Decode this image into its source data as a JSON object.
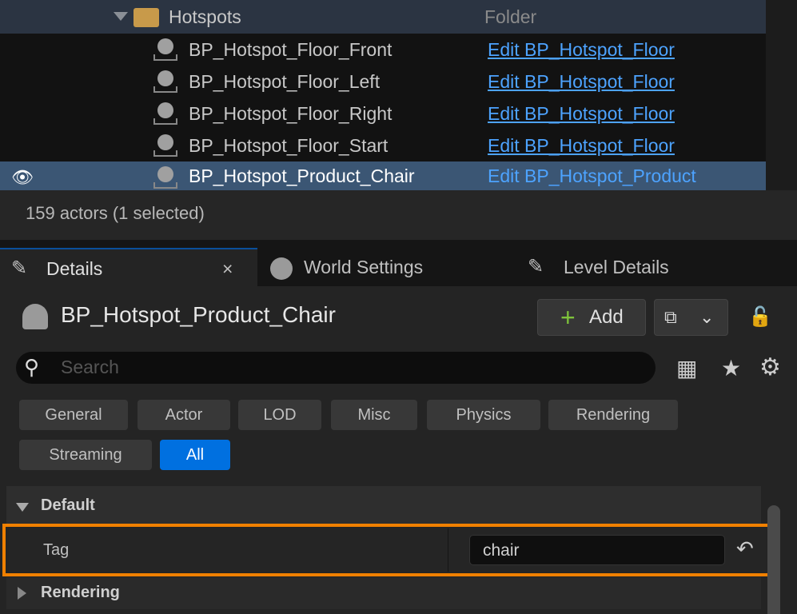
{
  "outliner": {
    "folder": {
      "name": "Hotspots",
      "type": "Folder"
    },
    "rows": [
      {
        "name": "BP_Hotspot_Floor_Front",
        "type": "Edit BP_Hotspot_Floor"
      },
      {
        "name": "BP_Hotspot_Floor_Left",
        "type": "Edit BP_Hotspot_Floor"
      },
      {
        "name": "BP_Hotspot_Floor_Right",
        "type": "Edit BP_Hotspot_Floor"
      },
      {
        "name": "BP_Hotspot_Floor_Start",
        "type": "Edit BP_Hotspot_Floor"
      },
      {
        "name": "BP_Hotspot_Product_Chair",
        "type": "Edit BP_Hotspot_Product",
        "selected": true
      }
    ],
    "status": "159 actors (1 selected)"
  },
  "tabs": [
    {
      "label": "Details",
      "close": "×"
    },
    {
      "label": "World Settings"
    },
    {
      "label": "Level Details"
    }
  ],
  "details": {
    "actor_name": "BP_Hotspot_Product_Chair",
    "add_label": "Add",
    "search_placeholder": "Search",
    "filters": [
      "General",
      "Actor",
      "LOD",
      "Misc",
      "Physics",
      "Rendering",
      "Streaming",
      "All"
    ],
    "active_filter": "All",
    "sections": [
      {
        "label": "Default",
        "expanded": true
      },
      {
        "label": "Rendering",
        "expanded": false
      }
    ],
    "property": {
      "label": "Tag",
      "value": "chair"
    },
    "colors": {
      "accent": "#0070e0",
      "highlight": "#f08000",
      "link": "#4da3ff",
      "add": "#7ec33b"
    }
  }
}
